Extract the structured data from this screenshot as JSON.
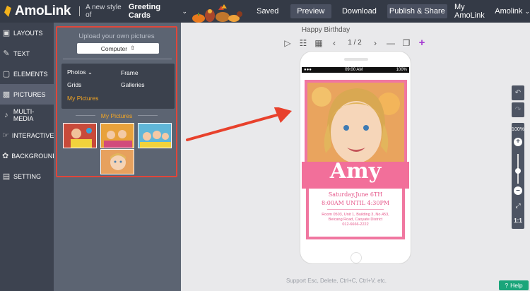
{
  "header": {
    "logo_text": "AmoLink",
    "tagline": "A new style of",
    "product": "Greeting Cards",
    "nav": {
      "saved": "Saved",
      "preview": "Preview",
      "download": "Download",
      "publish": "Publish & Share",
      "my_amolink": "My AmoLink",
      "user": "Amolink"
    }
  },
  "sidebar": {
    "items": [
      {
        "label": "LAYOUTS",
        "icon": "layouts-icon"
      },
      {
        "label": "TEXT",
        "icon": "text-icon"
      },
      {
        "label": "ELEMENTS",
        "icon": "elements-icon"
      },
      {
        "label": "PICTURES",
        "icon": "pictures-icon"
      },
      {
        "label": "MULTI-MEDIA",
        "icon": "multimedia-icon"
      },
      {
        "label": "INTERACTIVE",
        "icon": "interactive-icon"
      },
      {
        "label": "BACKGROUND",
        "icon": "background-icon"
      },
      {
        "label": "SETTING",
        "icon": "setting-icon"
      }
    ],
    "active_index": 3
  },
  "panel": {
    "upload_title": "Upload your own pictures",
    "upload_button": "Computer",
    "menu": {
      "photos": "Photos",
      "frame": "Frame",
      "grids": "Grids",
      "galleries": "Galleries",
      "my_pictures": "My Pictures"
    },
    "section_title": "My Pictures"
  },
  "canvas": {
    "title": "Happy Birthday",
    "page_indicator": "1 / 2",
    "status_time": "09:00  AM",
    "status_battery": "100%",
    "card": {
      "name": "Amy",
      "date": "Saturday,June 6TH",
      "time": "8:00AM UNTIL 4:30PM",
      "address_line1": "Room 0503, Unit 1, Building 3, No.453,",
      "address_line2": "Beicang Road, Caoyate District",
      "address_line3": "012-6666-2222"
    },
    "accent_color": "#f26f9a"
  },
  "zoom": {
    "level": "100%",
    "reset_label": "1:1"
  },
  "footer": {
    "hint": "Support Esc, Delete, Ctrl+C, Ctrl+V, etc.",
    "help": "Help"
  }
}
